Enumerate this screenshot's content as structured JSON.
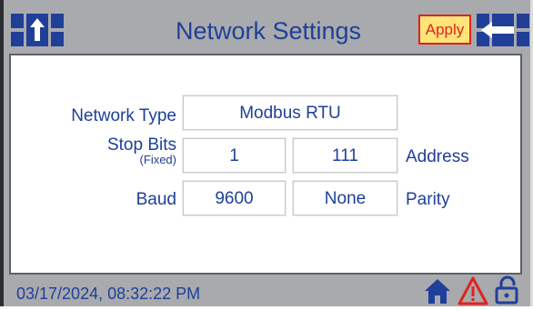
{
  "header": {
    "title": "Network Settings",
    "apply_label": "Apply"
  },
  "settings": {
    "network_type_label": "Network Type",
    "network_type_value": "Modbus RTU",
    "stop_bits_label": "Stop Bits",
    "stop_bits_sub": "(Fixed)",
    "stop_bits_value": "1",
    "address_value": "111",
    "address_label": "Address",
    "baud_label": "Baud",
    "baud_value": "9600",
    "parity_value": "None",
    "parity_label": "Parity"
  },
  "status_bar": {
    "datetime": "03/17/2024, 08:32:22 PM",
    "icons": [
      "home-icon",
      "warning-icon",
      "lock-icon"
    ]
  },
  "colors": {
    "text_blue": "#1f3f99",
    "apply_bg": "#ffe47a",
    "apply_border": "#e0221e",
    "screen_bg": "#a8aaad",
    "warning_red": "#e0221e"
  }
}
